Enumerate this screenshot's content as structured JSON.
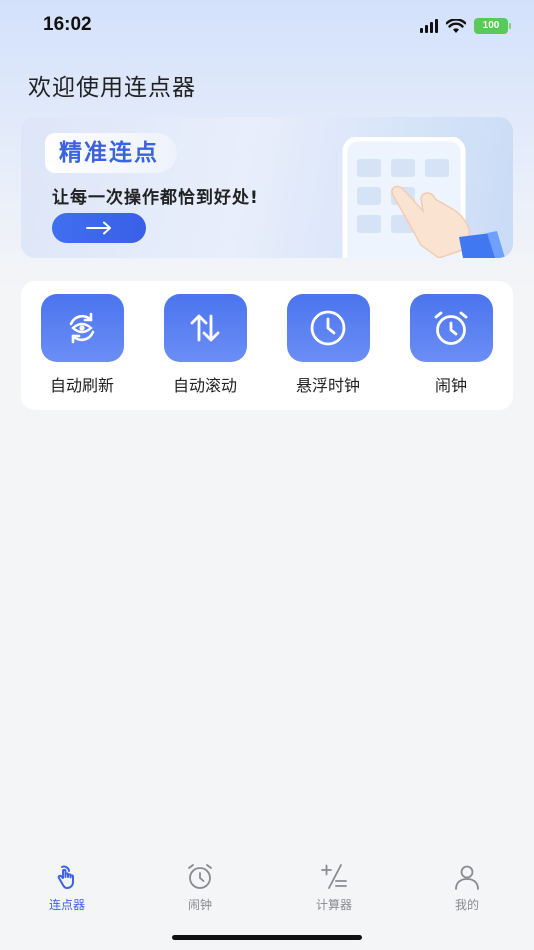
{
  "status_bar": {
    "time": "16:02",
    "battery": "100"
  },
  "page_title": "欢迎使用连点器",
  "banner": {
    "tag": "精准连点",
    "subtitle": "让每一次操作都恰到好处!",
    "button_icon": "arrow-right-icon"
  },
  "features": [
    {
      "label": "自动刷新",
      "icon": "refresh-eye-icon"
    },
    {
      "label": "自动滚动",
      "icon": "scroll-arrows-icon"
    },
    {
      "label": "悬浮时钟",
      "icon": "clock-icon"
    },
    {
      "label": "闹钟",
      "icon": "alarm-clock-icon"
    }
  ],
  "tabbar": {
    "items": [
      {
        "label": "连点器",
        "icon": "tap-hand-icon",
        "active": true
      },
      {
        "label": "闹钟",
        "icon": "alarm-clock-icon",
        "active": false
      },
      {
        "label": "计算器",
        "icon": "calculator-icon",
        "active": false
      },
      {
        "label": "我的",
        "icon": "person-icon",
        "active": false
      }
    ]
  },
  "colors": {
    "accent": "#3d63e6",
    "tile": "#5a80f1",
    "battery": "#5ac85a"
  }
}
